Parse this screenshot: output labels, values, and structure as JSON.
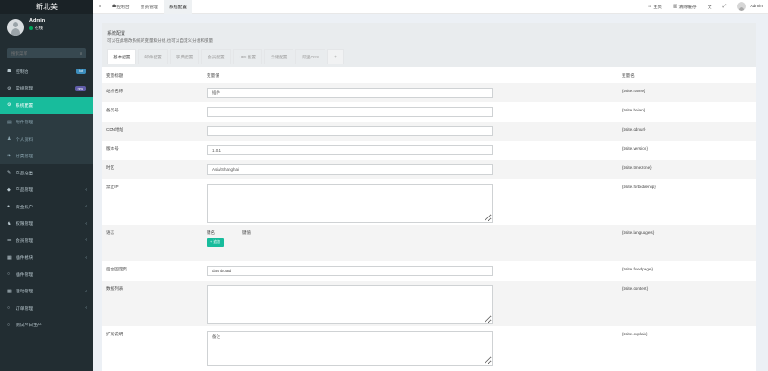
{
  "sidebar": {
    "logo": "新北美",
    "user": {
      "name": "Admin",
      "status": "在线"
    },
    "search_placeholder": "搜索菜单",
    "items": [
      {
        "label": "控制台",
        "icon": "dashboard-icon",
        "badge": "hot",
        "badge_color": "#3c8dbc",
        "style": "top"
      },
      {
        "label": "常规管理",
        "icon": "cogs-icon",
        "badge": "new",
        "badge_color": "#605ca8",
        "style": "top"
      },
      {
        "label": "系统配置",
        "icon": "gear-icon",
        "style": "active"
      },
      {
        "label": "附件管理",
        "icon": "file-icon",
        "style": "sub"
      },
      {
        "label": "个人资料",
        "icon": "user-icon",
        "style": "sub"
      },
      {
        "label": "分类管理",
        "icon": "leaf-icon",
        "style": "sub"
      },
      {
        "label": "产品分类",
        "icon": "tag-icon",
        "style": "top"
      },
      {
        "label": "产品管理",
        "icon": "diamond-icon",
        "arrow": true,
        "style": "top"
      },
      {
        "label": "资金账户",
        "icon": "circle-icon",
        "arrow": true,
        "style": "top"
      },
      {
        "label": "权限管理",
        "icon": "users-icon",
        "arrow": true,
        "style": "top"
      },
      {
        "label": "会员管理",
        "icon": "list-icon",
        "arrow": true,
        "style": "top"
      },
      {
        "label": "插件模块",
        "icon": "puzzle-icon",
        "arrow": true,
        "style": "top"
      },
      {
        "label": "插件管理",
        "icon": "circle-o-icon",
        "style": "top"
      },
      {
        "label": "活动管理",
        "icon": "table-icon",
        "arrow": true,
        "style": "top"
      },
      {
        "label": "订单管理",
        "icon": "circle-o-icon",
        "arrow": true,
        "style": "top"
      },
      {
        "label": "测试今日生产",
        "icon": "circle-o-icon",
        "style": "top"
      }
    ]
  },
  "topbar": {
    "menu_icon": "hamburger-icon",
    "tabs": [
      {
        "label": "控制台",
        "icon": "dashboard-icon"
      },
      {
        "label": "会员管理"
      },
      {
        "label": "系统配置",
        "active": true
      }
    ],
    "right": [
      {
        "label": "主页",
        "icon": "home-icon"
      },
      {
        "label": "清除缓存",
        "icon": "trash-icon"
      },
      {
        "label": "",
        "icon": "translate-icon"
      },
      {
        "label": "",
        "icon": "expand-icon"
      }
    ],
    "user": "Admin"
  },
  "panel": {
    "title": "系统配置",
    "description": "可以在此增改系统的变量和分组,也可以自定义分组和变量",
    "tabs": [
      "基本配置",
      "邮件配置",
      "字典配置",
      "会员配置",
      "URL配置",
      "云储配置",
      "阿里OSS",
      "+"
    ],
    "headers": {
      "title": "变量标题",
      "value": "变量值",
      "name": "变量名"
    },
    "rows": [
      {
        "title": "站点名称",
        "type": "input",
        "value": "插件",
        "name": "{$site.name}"
      },
      {
        "title": "备案号",
        "type": "input",
        "value": "",
        "name": "{$site.beian}"
      },
      {
        "title": "CDN地址",
        "type": "input",
        "value": "",
        "name": "{$site.cdnurl}"
      },
      {
        "title": "版本号",
        "type": "input",
        "value": "1.0.1",
        "name": "{$site.version}"
      },
      {
        "title": "时区",
        "type": "input",
        "value": "Asia/Shanghai",
        "name": "{$site.timezone}"
      },
      {
        "title": "禁止IP",
        "type": "textarea",
        "value": "",
        "name": "{$site.forbiddenip}"
      },
      {
        "title": "语言",
        "type": "kv",
        "key_label": "键名",
        "val_label": "键值",
        "button": "追加",
        "name": "{$site.languages}"
      },
      {
        "title": "后台固定页",
        "type": "input",
        "value": "dashboard",
        "name": "{$site.fixedpage}"
      },
      {
        "title": "数据列表",
        "type": "textarea",
        "value": "",
        "name": "{$site.content}"
      },
      {
        "title": "扩展说明",
        "type": "textarea",
        "value": "备注",
        "name": "{$site.explain}"
      }
    ]
  }
}
